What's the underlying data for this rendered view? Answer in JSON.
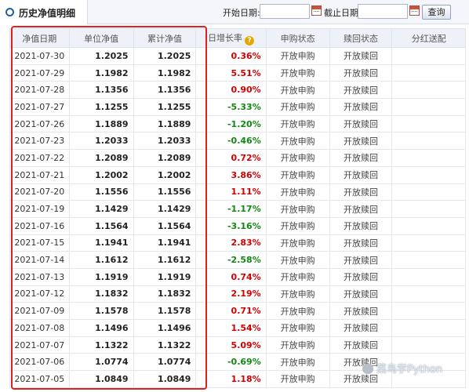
{
  "header": {
    "title": "历史净值明细",
    "start_label": "开始日期:",
    "start_value": "",
    "end_label": "截止日期:",
    "end_value": "",
    "query_label": "查询"
  },
  "table": {
    "columns": [
      "净值日期",
      "单位净值",
      "累计净值",
      "日增长率",
      "申购状态",
      "赎回状态",
      "分红送配"
    ],
    "help_icon": "?",
    "rows": [
      {
        "date": "2021-07-30",
        "unit": "1.2025",
        "acc": "1.2025",
        "rate": "0.36%",
        "dir": "up",
        "buy": "开放申购",
        "redeem": "开放赎回",
        "div": ""
      },
      {
        "date": "2021-07-29",
        "unit": "1.1982",
        "acc": "1.1982",
        "rate": "5.51%",
        "dir": "up",
        "buy": "开放申购",
        "redeem": "开放赎回",
        "div": ""
      },
      {
        "date": "2021-07-28",
        "unit": "1.1356",
        "acc": "1.1356",
        "rate": "0.90%",
        "dir": "up",
        "buy": "开放申购",
        "redeem": "开放赎回",
        "div": ""
      },
      {
        "date": "2021-07-27",
        "unit": "1.1255",
        "acc": "1.1255",
        "rate": "-5.33%",
        "dir": "down",
        "buy": "开放申购",
        "redeem": "开放赎回",
        "div": ""
      },
      {
        "date": "2021-07-26",
        "unit": "1.1889",
        "acc": "1.1889",
        "rate": "-1.20%",
        "dir": "down",
        "buy": "开放申购",
        "redeem": "开放赎回",
        "div": ""
      },
      {
        "date": "2021-07-23",
        "unit": "1.2033",
        "acc": "1.2033",
        "rate": "-0.46%",
        "dir": "down",
        "buy": "开放申购",
        "redeem": "开放赎回",
        "div": ""
      },
      {
        "date": "2021-07-22",
        "unit": "1.2089",
        "acc": "1.2089",
        "rate": "0.72%",
        "dir": "up",
        "buy": "开放申购",
        "redeem": "开放赎回",
        "div": ""
      },
      {
        "date": "2021-07-21",
        "unit": "1.2002",
        "acc": "1.2002",
        "rate": "3.86%",
        "dir": "up",
        "buy": "开放申购",
        "redeem": "开放赎回",
        "div": ""
      },
      {
        "date": "2021-07-20",
        "unit": "1.1556",
        "acc": "1.1556",
        "rate": "1.11%",
        "dir": "up",
        "buy": "开放申购",
        "redeem": "开放赎回",
        "div": ""
      },
      {
        "date": "2021-07-19",
        "unit": "1.1429",
        "acc": "1.1429",
        "rate": "-1.17%",
        "dir": "down",
        "buy": "开放申购",
        "redeem": "开放赎回",
        "div": ""
      },
      {
        "date": "2021-07-16",
        "unit": "1.1564",
        "acc": "1.1564",
        "rate": "-3.16%",
        "dir": "down",
        "buy": "开放申购",
        "redeem": "开放赎回",
        "div": ""
      },
      {
        "date": "2021-07-15",
        "unit": "1.1941",
        "acc": "1.1941",
        "rate": "2.83%",
        "dir": "up",
        "buy": "开放申购",
        "redeem": "开放赎回",
        "div": ""
      },
      {
        "date": "2021-07-14",
        "unit": "1.1612",
        "acc": "1.1612",
        "rate": "-2.58%",
        "dir": "down",
        "buy": "开放申购",
        "redeem": "开放赎回",
        "div": ""
      },
      {
        "date": "2021-07-13",
        "unit": "1.1919",
        "acc": "1.1919",
        "rate": "0.74%",
        "dir": "up",
        "buy": "开放申购",
        "redeem": "开放赎回",
        "div": ""
      },
      {
        "date": "2021-07-12",
        "unit": "1.1832",
        "acc": "1.1832",
        "rate": "2.19%",
        "dir": "up",
        "buy": "开放申购",
        "redeem": "开放赎回",
        "div": ""
      },
      {
        "date": "2021-07-09",
        "unit": "1.1578",
        "acc": "1.1578",
        "rate": "0.71%",
        "dir": "up",
        "buy": "开放申购",
        "redeem": "开放赎回",
        "div": ""
      },
      {
        "date": "2021-07-08",
        "unit": "1.1496",
        "acc": "1.1496",
        "rate": "1.54%",
        "dir": "up",
        "buy": "开放申购",
        "redeem": "开放赎回",
        "div": ""
      },
      {
        "date": "2021-07-07",
        "unit": "1.1322",
        "acc": "1.1322",
        "rate": "5.09%",
        "dir": "up",
        "buy": "开放申购",
        "redeem": "开放赎回",
        "div": ""
      },
      {
        "date": "2021-07-06",
        "unit": "1.0774",
        "acc": "1.0774",
        "rate": "-0.69%",
        "dir": "down",
        "buy": "开放申购",
        "redeem": "开放赎回",
        "div": ""
      },
      {
        "date": "2021-07-05",
        "unit": "1.0849",
        "acc": "1.0849",
        "rate": "1.18%",
        "dir": "up",
        "buy": "开放申购",
        "redeem": "开放赎回",
        "div": ""
      }
    ]
  },
  "watermark": "菜鸟学Python",
  "colors": {
    "up": "#d60000",
    "down": "#118811",
    "highlight": "#e02020",
    "accent": "#1f5fa8"
  }
}
